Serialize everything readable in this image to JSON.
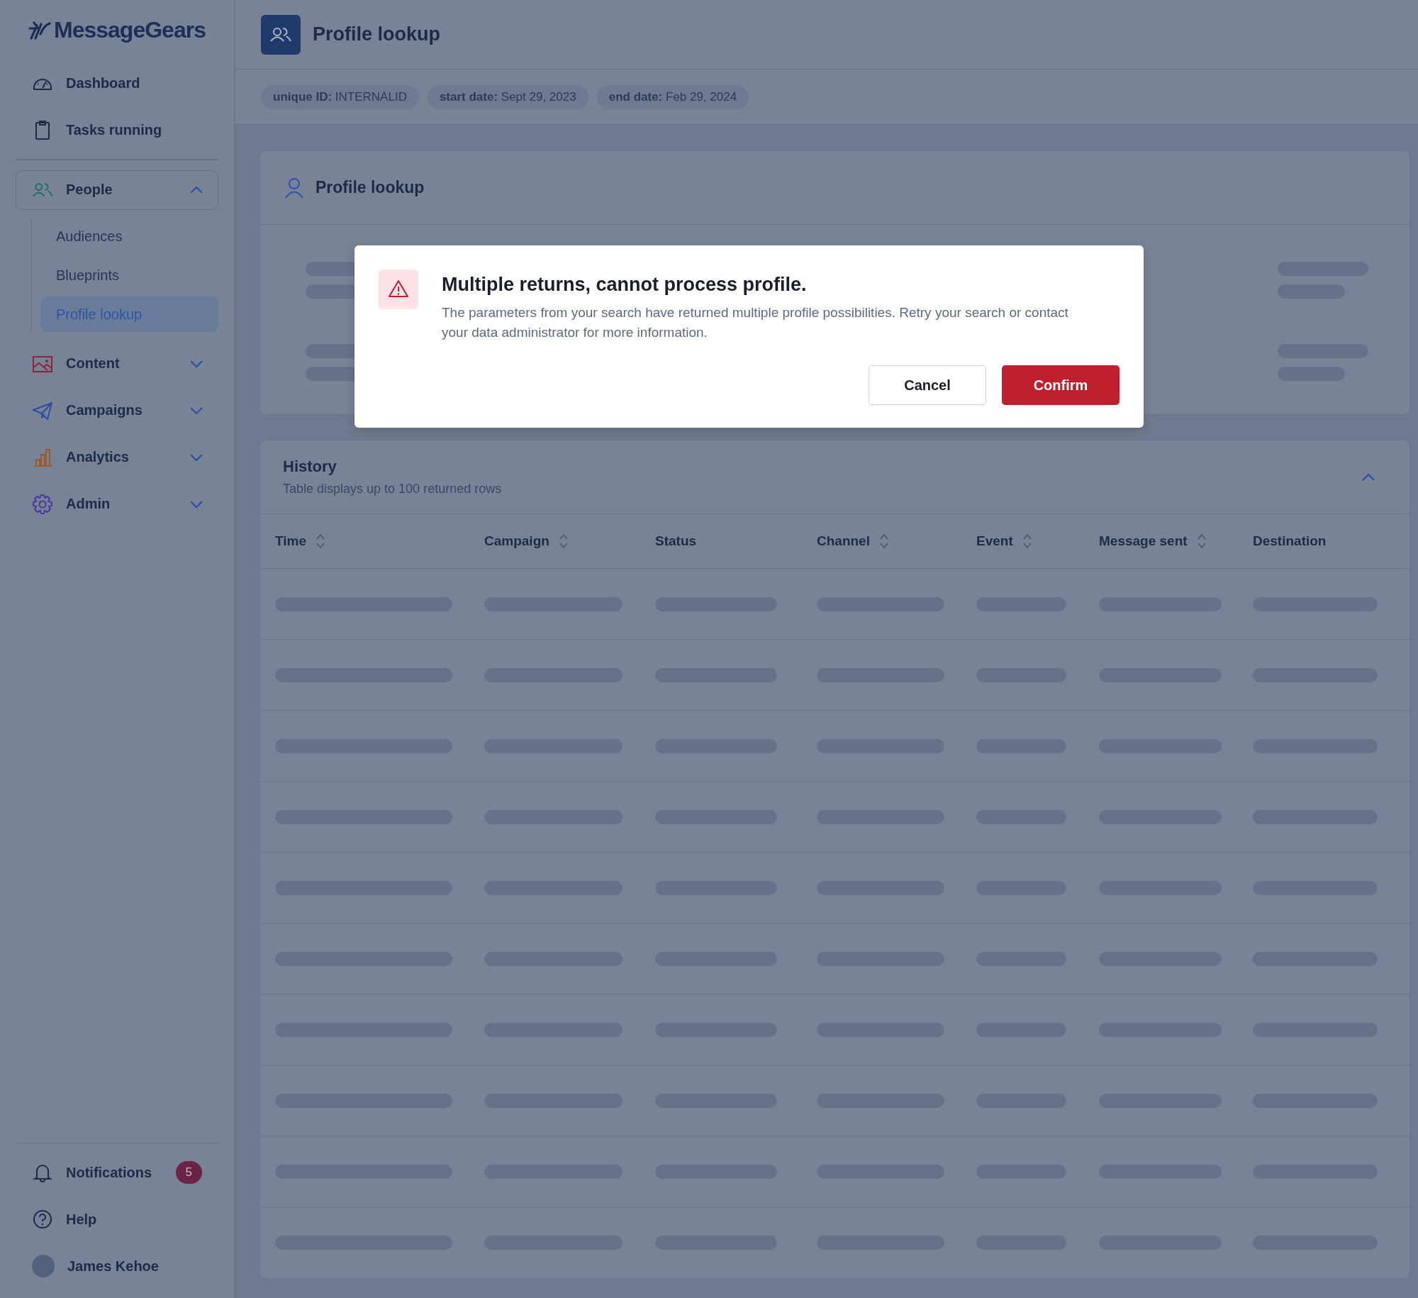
{
  "sidebar": {
    "logo": "MessageGears",
    "items": [
      {
        "label": "Dashboard",
        "kind": "link"
      },
      {
        "label": "Tasks running",
        "kind": "link"
      },
      {
        "label": "People",
        "kind": "group",
        "expanded": true,
        "children": [
          {
            "label": "Audiences",
            "selected": false
          },
          {
            "label": "Blueprints",
            "selected": false
          },
          {
            "label": "Profile lookup",
            "selected": true
          }
        ]
      },
      {
        "label": "Content",
        "kind": "group",
        "expanded": false
      },
      {
        "label": "Campaigns",
        "kind": "group",
        "expanded": false
      },
      {
        "label": "Analytics",
        "kind": "group",
        "expanded": false
      },
      {
        "label": "Admin",
        "kind": "group",
        "expanded": false
      }
    ],
    "bottom": [
      {
        "label": "Notifications",
        "kind": "notifications",
        "badge": "5"
      },
      {
        "label": "Help",
        "kind": "help"
      },
      {
        "label": "James Kehoe",
        "kind": "user"
      }
    ]
  },
  "header": {
    "title": "Profile lookup"
  },
  "chips": [
    "**unique ID:** INTERNALID",
    "**start date:** Sept 29, 2023",
    "**end date:** Feb 29, 2024"
  ],
  "profile_card": {
    "title": "Profile lookup",
    "loading": true
  },
  "dialog": {
    "title": "Multiple returns, cannot process profile.",
    "message": "The parameters from your search have returned multiple profile possibilities. Retry your search or contact your data administrator for more information.",
    "buttons": [
      {
        "label": "Cancel",
        "kind": "secondary"
      },
      {
        "label": "Confirm",
        "kind": "primary"
      }
    ]
  },
  "history": {
    "title": "History",
    "subtitle": "Table displays up to 100 returned rows",
    "expanded": true,
    "loading": true,
    "columns": [
      {
        "label": "Time",
        "sortable": true
      },
      {
        "label": "Campaign",
        "sortable": true
      },
      {
        "label": "Status",
        "sortable": false
      },
      {
        "label": "Channel",
        "sortable": true
      },
      {
        "label": "Event",
        "sortable": true
      },
      {
        "label": "Message sent",
        "sortable": true
      },
      {
        "label": "Destination",
        "sortable": false
      }
    ]
  }
}
